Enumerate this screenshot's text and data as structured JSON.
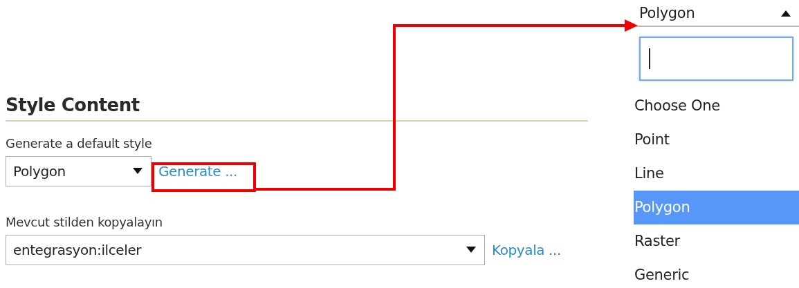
{
  "section": {
    "title": "Style Content"
  },
  "generate": {
    "label": "Generate a default style",
    "select": {
      "value": "Polygon"
    },
    "link": "Generate ..."
  },
  "copy": {
    "label": "Mevcut stilden kopyalayın",
    "select": {
      "value": "entegrasyon:ilceler"
    },
    "link": "Kopyala ..."
  },
  "dropdown": {
    "value": "Polygon",
    "expanded": true,
    "search": {
      "focused": true
    },
    "options": [
      {
        "label": "Choose One",
        "selected": false
      },
      {
        "label": "Point",
        "selected": false
      },
      {
        "label": "Line",
        "selected": false
      },
      {
        "label": "Polygon",
        "selected": true
      },
      {
        "label": "Raster",
        "selected": false
      },
      {
        "label": "Generic",
        "selected": false
      }
    ]
  }
}
